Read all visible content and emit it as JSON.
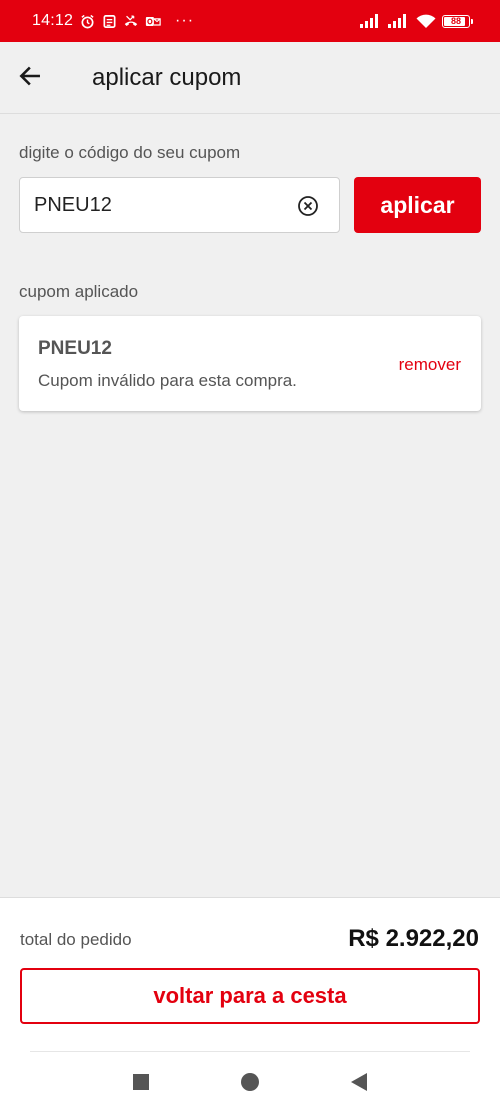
{
  "status_bar": {
    "time": "14:12",
    "more": "···",
    "battery": "88",
    "battery_level": 0.88,
    "icons": [
      "alarm-icon",
      "notes-icon",
      "missed-call-icon",
      "outlook-icon",
      "signal-icon",
      "signal-icon",
      "wifi-icon",
      "battery-icon"
    ]
  },
  "app_bar": {
    "title": "aplicar cupom",
    "back_icon": "arrow-left-icon"
  },
  "coupon_input": {
    "label": "digite o código do seu cupom",
    "value": "PNEU12",
    "clear_icon": "clear-circle-icon",
    "apply_label": "aplicar"
  },
  "applied": {
    "label": "cupom aplicado",
    "code": "PNEU12",
    "message": "Cupom inválido para esta compra.",
    "remove_label": "remover"
  },
  "summary": {
    "total_label": "total do pedido",
    "total_value": "R$ 2.922,20",
    "back_button": "voltar para a cesta"
  },
  "nav": {
    "icons": [
      "recents-square-icon",
      "home-circle-icon",
      "back-triangle-icon"
    ]
  },
  "colors": {
    "brand": "#e3000f",
    "background": "#f0f0f0",
    "caret": "#f2c200"
  }
}
